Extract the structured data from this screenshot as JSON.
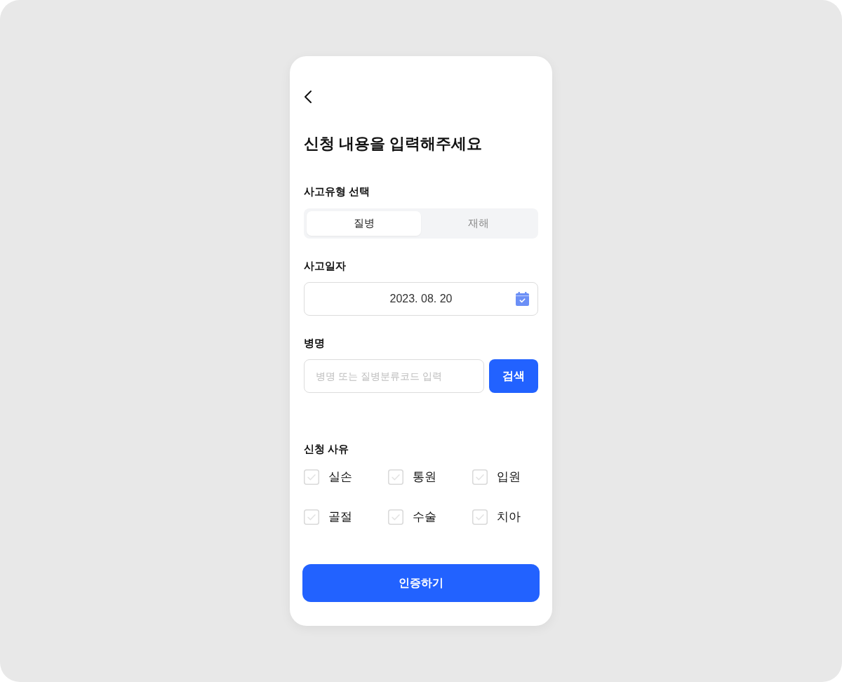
{
  "header": {
    "title": "신청 내용을 입력해주세요"
  },
  "accident_type": {
    "label": "사고유형 선택",
    "options": [
      {
        "label": "질병",
        "selected": true
      },
      {
        "label": "재해",
        "selected": false
      }
    ]
  },
  "accident_date": {
    "label": "사고일자",
    "value": "2023. 08. 20"
  },
  "disease": {
    "label": "병명",
    "placeholder": "병명 또는 질병분류코드 입력",
    "button": "검색"
  },
  "reasons": {
    "label": "신청 사유",
    "items": [
      {
        "label": "실손",
        "checked": false
      },
      {
        "label": "통원",
        "checked": false
      },
      {
        "label": "입원",
        "checked": false
      },
      {
        "label": "골절",
        "checked": false
      },
      {
        "label": "수술",
        "checked": false
      },
      {
        "label": "치아",
        "checked": false
      }
    ]
  },
  "submit": {
    "label": "인증하기"
  }
}
